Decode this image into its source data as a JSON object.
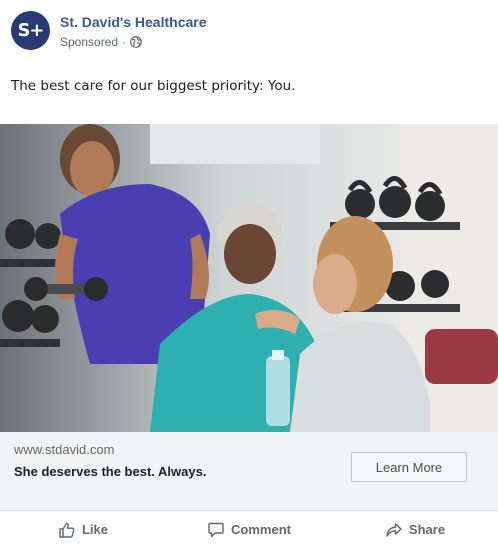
{
  "post": {
    "page_name": "St. David's Healthcare",
    "avatar_text": "S+",
    "sponsored": "Sponsored",
    "separator": "·",
    "privacy_icon": "globe-icon",
    "text": "The best care for our biggest priority: You."
  },
  "ad": {
    "image_icon": "gym-photo",
    "url": "www.stdavid.com",
    "headline": "She deserves the best. Always.",
    "cta_label": "Learn More"
  },
  "actions": {
    "like_label": "Like",
    "comment_label": "Comment",
    "share_label": "Share"
  },
  "colors": {
    "brand": "#283a74",
    "link": "#3b5998",
    "footer_bg": "#f2f3f5"
  }
}
